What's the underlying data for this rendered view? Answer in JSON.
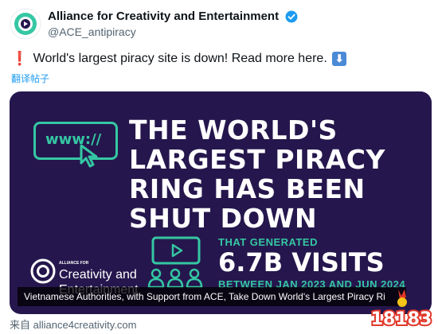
{
  "author": {
    "name": "Alliance for Creativity and Entertainment",
    "handle": "@ACE_antipiracy"
  },
  "tweet": {
    "exclamation": "❗",
    "text": "World's largest piracy site is down! Read more here.",
    "arrow": "⬇"
  },
  "translate_label": "翻译帖子",
  "card": {
    "url_icon_text": "www://",
    "headline": "THE WORLD'S\nLARGEST PIRACY\nRING HAS BEEN\nSHUT DOWN",
    "stat_intro": "THAT GENERATED",
    "stat_value": "6.7B VISITS",
    "stat_range": "BETWEEN JAN 2023 AND JUN 2024",
    "logo_small": "ALLIANCE FOR",
    "logo_line1": "Creativity and",
    "logo_line2": "Entertainment",
    "caption": "Vietnamese Authorities, with Support from ACE, Take Down World's Largest Piracy Ri"
  },
  "source": "来自 alliance4creativity.com",
  "watermark": "18183",
  "colors": {
    "card_bg": "#25174d",
    "accent": "#35c7a3",
    "link": "#1d9bf0",
    "verified": "#1d9bf0"
  }
}
